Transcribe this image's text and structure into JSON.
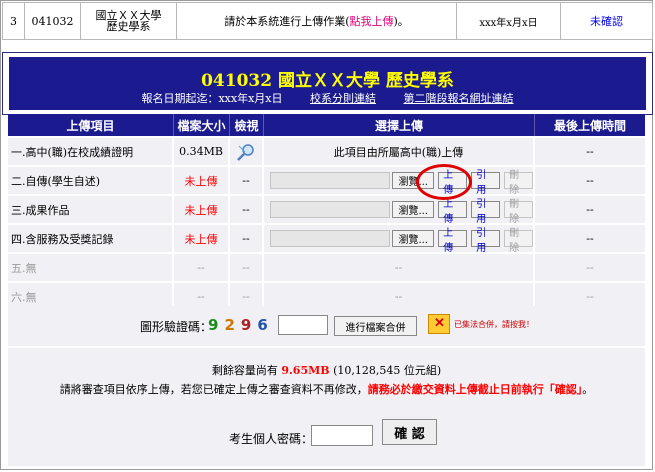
{
  "top_row": {
    "index": "3",
    "code": "041032",
    "school_line1": "國立ＸＸ大學",
    "school_line2": "歷史學系",
    "message_prefix": "請於本系統進行上傳作業(",
    "message_link": "點我上傳",
    "message_suffix": ")。",
    "date": "xxx年x月x日",
    "status": "未確認"
  },
  "banner": {
    "title": "041032 國立ＸＸ大學 歷史學系",
    "deadline": "報名日期起迄：xxx年x月x日",
    "link_rules": "校系分則連結",
    "link_stage2": "第二階段報名網址連結"
  },
  "table": {
    "headers": [
      "上傳項目",
      "檔案大小",
      "檢視",
      "選擇上傳",
      "最後上傳時間"
    ],
    "rows": [
      {
        "item": "一.高中(職)在校成績證明",
        "size": "0.34MB",
        "view": "",
        "upload_text": "此項目由所屬高中(職)上傳",
        "last_time": "--"
      },
      {
        "item": "二.自傳(學生自述)",
        "size": "未上傳",
        "view": "--",
        "last_time": "--"
      },
      {
        "item": "三.成果作品",
        "size": "未上傳",
        "view": "--",
        "last_time": "--"
      },
      {
        "item": "四.含服務及受獎記錄",
        "size": "未上傳",
        "view": "--",
        "last_time": "--"
      },
      {
        "item": "五.無",
        "size": "--",
        "view": "--",
        "upload_text": "--",
        "last_time": "--"
      },
      {
        "item": "六.無",
        "size": "--",
        "view": "--",
        "upload_text": "--",
        "last_time": "--"
      }
    ],
    "browse_label": "瀏覽...",
    "upload_label": "上傳",
    "cite_label": "引用",
    "delete_label": "刪除"
  },
  "captcha": {
    "label": "圖形驗證碼：",
    "digits": [
      "9",
      "2",
      "9",
      "6"
    ],
    "merge_button": "進行檔案合併",
    "merge_note": "已集法合併，請按我！"
  },
  "info": {
    "remaining_prefix": "剩餘容量尚有",
    "remaining_value": "9.65MB",
    "remaining_suffix": "(10,128,545 位元組)",
    "notice_prefix": "請將審查項目依序上傳，若您已確定上傳之審查資料不再修改，",
    "notice_red": "請務必於繳交資料上傳截止日前執行「確認」",
    "notice_suffix": "。",
    "password_label": "考生個人密碼：",
    "confirm_button": "確 認"
  },
  "colors": {
    "banner_bg": "#1b1b8f",
    "title_yellow": "#ffff00",
    "warning_red": "#ff0000",
    "row_bg": "#f0f0f5"
  }
}
